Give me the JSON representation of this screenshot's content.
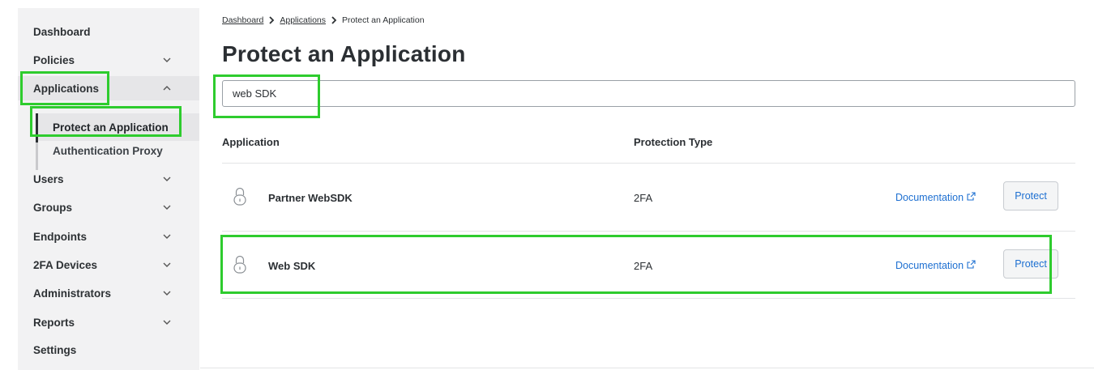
{
  "sidebar": {
    "items": [
      {
        "label": "Dashboard"
      },
      {
        "label": "Policies"
      },
      {
        "label": "Applications"
      },
      {
        "label": "Users"
      },
      {
        "label": "Groups"
      },
      {
        "label": "Endpoints"
      },
      {
        "label": "2FA Devices"
      },
      {
        "label": "Administrators"
      },
      {
        "label": "Reports"
      },
      {
        "label": "Settings"
      }
    ],
    "subitems": [
      {
        "label": "Protect an Application"
      },
      {
        "label": "Authentication Proxy"
      }
    ]
  },
  "breadcrumb": {
    "items": [
      "Dashboard",
      "Applications",
      "Protect an Application"
    ]
  },
  "page": {
    "title": "Protect an Application"
  },
  "search": {
    "value": "web SDK"
  },
  "table": {
    "columns": [
      "Application",
      "Protection Type"
    ],
    "rows": [
      {
        "name": "Partner WebSDK",
        "protection_type": "2FA",
        "doc_label": "Documentation",
        "action_label": "Protect"
      },
      {
        "name": "Web SDK",
        "protection_type": "2FA",
        "doc_label": "Documentation",
        "action_label": "Protect"
      }
    ]
  },
  "colors": {
    "highlight": "#2ecc2e",
    "link": "#1d6fd1",
    "sidebar_bg": "#f2f2f3"
  },
  "icons": [
    "chevron-down-icon",
    "chevron-up-icon",
    "chevron-right-icon",
    "lock-icon",
    "external-link-icon"
  ]
}
